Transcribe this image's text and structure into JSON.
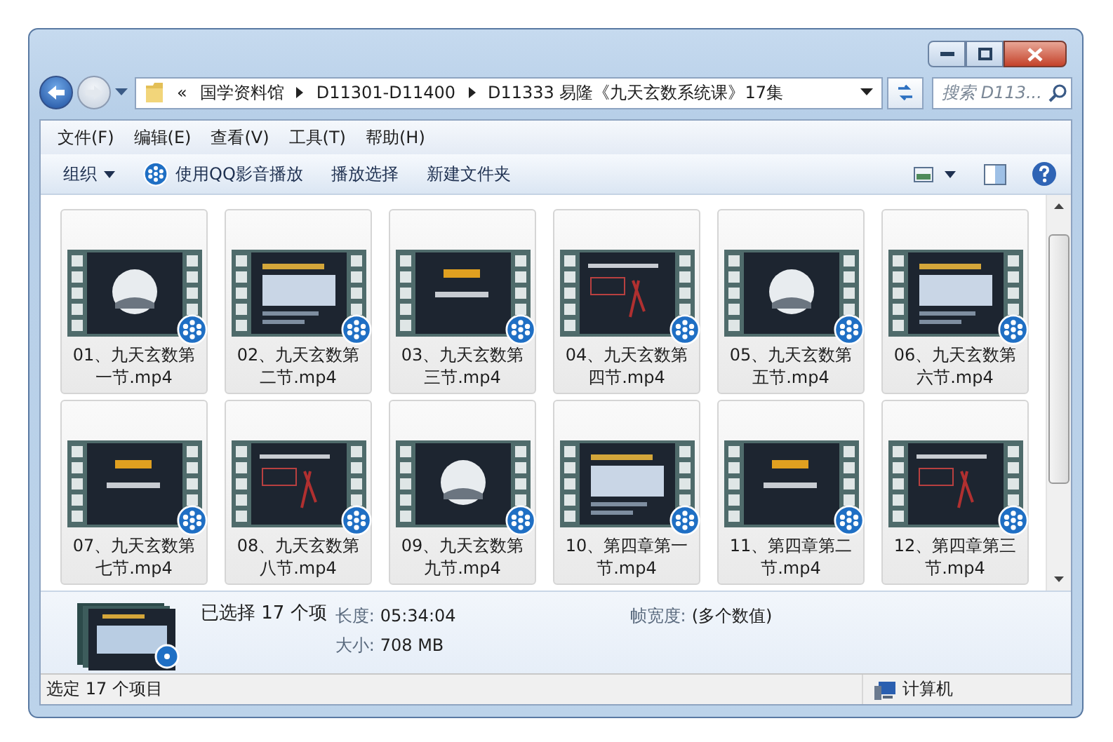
{
  "address_bar": {
    "overflow": "«",
    "crumbs": [
      "国学资料馆",
      "D11301-D11400",
      "D11333 易隆《九天玄数系统课》17集"
    ]
  },
  "search": {
    "placeholder": "搜索 D113..."
  },
  "menu": [
    "文件(F)",
    "编辑(E)",
    "查看(V)",
    "工具(T)",
    "帮助(H)"
  ],
  "toolbar": [
    {
      "label": "组织",
      "kind": "dropdown"
    },
    {
      "label": "使用QQ影音播放",
      "kind": "player"
    },
    {
      "label": "播放选择",
      "kind": "plain"
    },
    {
      "label": "新建文件夹",
      "kind": "plain"
    }
  ],
  "files": [
    {
      "name": "01、九天玄数第一节.mp4",
      "selected": true
    },
    {
      "name": "02、九天玄数第二节.mp4",
      "selected": true
    },
    {
      "name": "03、九天玄数第三节.mp4",
      "selected": true
    },
    {
      "name": "04、九天玄数第四节.mp4",
      "selected": true
    },
    {
      "name": "05、九天玄数第五节.mp4",
      "selected": true
    },
    {
      "name": "06、九天玄数第六节.mp4",
      "selected": true
    },
    {
      "name": "07、九天玄数第七节.mp4",
      "selected": true
    },
    {
      "name": "08、九天玄数第八节.mp4",
      "selected": true
    },
    {
      "name": "09、九天玄数第九节.mp4",
      "selected": true
    },
    {
      "name": "10、第四章第一节.mp4",
      "selected": true
    },
    {
      "name": "11、第四章第二节.mp4",
      "selected": true
    },
    {
      "name": "12、第四章第三节.mp4",
      "selected": true
    }
  ],
  "details": {
    "summary": "已选择 17 个项",
    "fields": [
      {
        "label": "长度:",
        "value": "05:34:04"
      },
      {
        "label": "大小:",
        "value": "708 MB"
      },
      {
        "label": "帧宽度:",
        "value": "(多个数值)"
      }
    ]
  },
  "status_bar": {
    "text": "选定 17 个项目",
    "location": "计算机"
  }
}
